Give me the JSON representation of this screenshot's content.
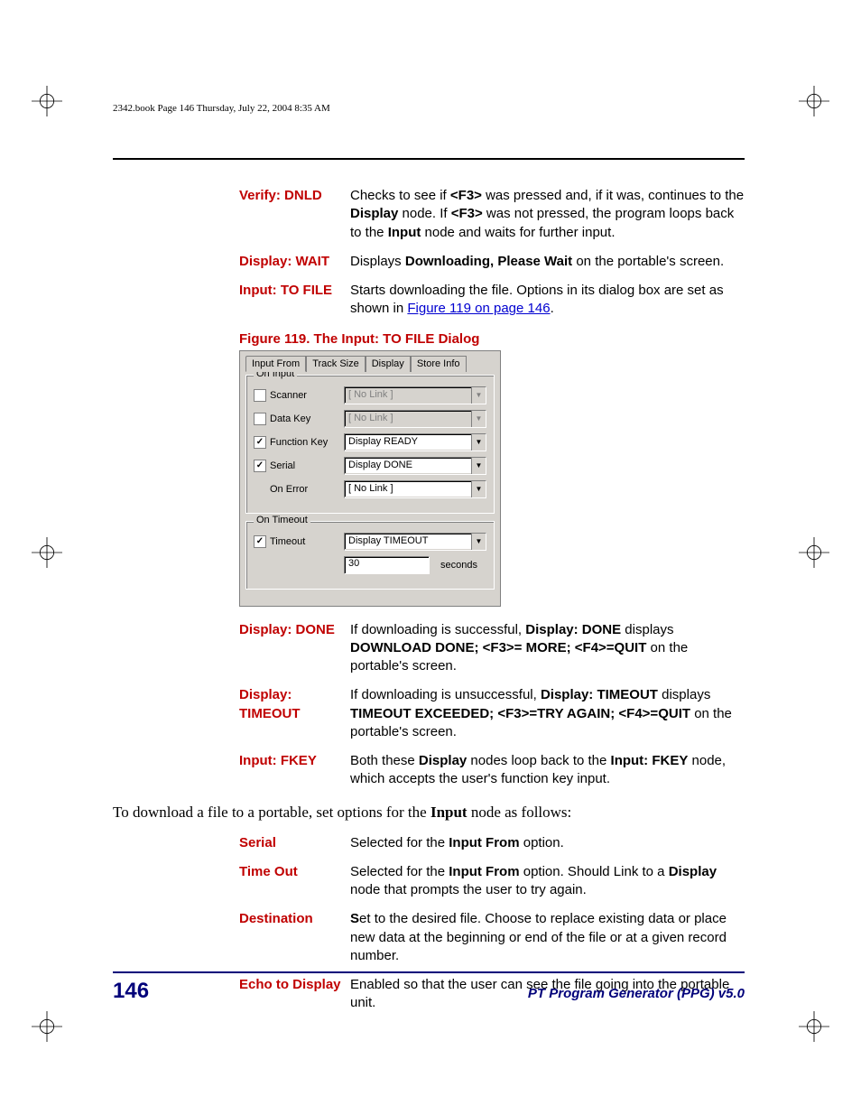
{
  "header": "2342.book  Page 146  Thursday, July 22, 2004  8:35 AM",
  "defs1": [
    {
      "term": "Verify: DNLD",
      "body_html": "Checks to see if <b>&lt;F3&gt;</b> was pressed and, if it was, continues to the <b>Display</b> node. If <b>&lt;F3&gt;</b> was not pressed, the program loops back to the <b>Input</b> node and waits for further input."
    },
    {
      "term": "Display: WAIT",
      "body_html": "Displays <b>Downloading, Please Wait</b> on the portable's screen."
    },
    {
      "term": "Input: TO FILE",
      "body_html": "Starts downloading the file. Options in its dialog box are set as shown in <a class=\"link\">Figure 119 on page 146</a>."
    }
  ],
  "figure_caption": "Figure 119. The Input: TO FILE Dialog",
  "dialog": {
    "tabs": [
      "Input From",
      "Track Size",
      "Display",
      "Store Info"
    ],
    "onInput": {
      "legend": "On Input",
      "rows": [
        {
          "cb": false,
          "label": "Scanner",
          "value": "[ No Link ]",
          "disabled": true
        },
        {
          "cb": false,
          "label": "Data Key",
          "value": "[ No Link ]",
          "disabled": true
        },
        {
          "cb": true,
          "label": "Function Key",
          "value": "Display READY",
          "disabled": false
        },
        {
          "cb": true,
          "label": "Serial",
          "value": "Display DONE",
          "disabled": false
        },
        {
          "cb": null,
          "label": "On Error",
          "value": "[ No Link ]",
          "disabled": false
        }
      ]
    },
    "onTimeout": {
      "legend": "On Timeout",
      "row": {
        "cb": true,
        "label": "Timeout",
        "value": "Display TIMEOUT"
      },
      "seconds_value": "30",
      "seconds_label": "seconds"
    }
  },
  "defs2": [
    {
      "term": "Display: DONE",
      "body_html": "If downloading is successful, <b>Display: DONE</b> displays <b>DOWNLOAD DONE; &lt;F3&gt;= MORE; &lt;F4&gt;=QUIT</b> on the portable's screen."
    },
    {
      "term": "Display: TIMEOUT",
      "body_html": "If downloading is unsuccessful, <b>Display: TIMEOUT</b> displays <b>TIMEOUT EXCEEDED; &lt;F3&gt;=TRY AGAIN; &lt;F4&gt;=QUIT</b> on the portable's screen."
    },
    {
      "term": "Input: FKEY",
      "body_html": "Both these <b>Display</b> nodes loop back to the <b>Input: FKEY</b> node, which accepts the user's function key input."
    }
  ],
  "body_para": "To download a file to a portable, set options for the <b>Input</b> node as follows:",
  "defs3": [
    {
      "term": "Serial",
      "body_html": "Selected for the <b>Input From</b> option."
    },
    {
      "term": "Time Out",
      "body_html": "Selected for the <b>Input From</b> option. Should Link to a <b>Display</b> node that prompts the user to try again."
    },
    {
      "term": "Destination",
      "body_html": "<b>S</b>et to the desired file. Choose to replace existing data or place new data at the beginning or end of the file or at a given record number."
    },
    {
      "term": "Echo to Display",
      "body_html": "Enabled so that the user can see the file going into the portable unit."
    }
  ],
  "footer": {
    "page": "146",
    "title": "PT Program Generator (PPG)  v5.0"
  }
}
